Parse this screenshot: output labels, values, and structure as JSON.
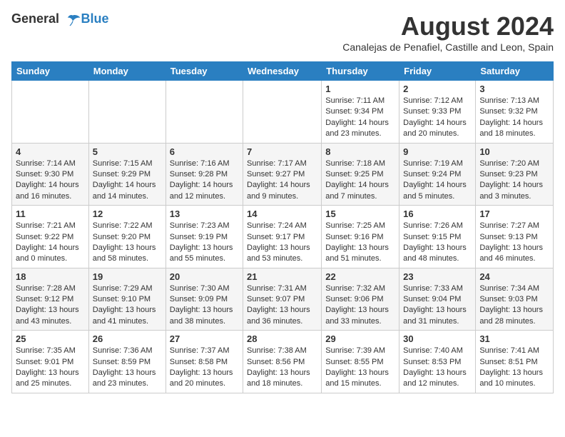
{
  "header": {
    "logo_general": "General",
    "logo_blue": "Blue",
    "month_year": "August 2024",
    "location": "Canalejas de Penafiel, Castille and Leon, Spain"
  },
  "weekdays": [
    "Sunday",
    "Monday",
    "Tuesday",
    "Wednesday",
    "Thursday",
    "Friday",
    "Saturday"
  ],
  "weeks": [
    [
      {
        "day": "",
        "info": ""
      },
      {
        "day": "",
        "info": ""
      },
      {
        "day": "",
        "info": ""
      },
      {
        "day": "",
        "info": ""
      },
      {
        "day": "1",
        "info": "Sunrise: 7:11 AM\nSunset: 9:34 PM\nDaylight: 14 hours\nand 23 minutes."
      },
      {
        "day": "2",
        "info": "Sunrise: 7:12 AM\nSunset: 9:33 PM\nDaylight: 14 hours\nand 20 minutes."
      },
      {
        "day": "3",
        "info": "Sunrise: 7:13 AM\nSunset: 9:32 PM\nDaylight: 14 hours\nand 18 minutes."
      }
    ],
    [
      {
        "day": "4",
        "info": "Sunrise: 7:14 AM\nSunset: 9:30 PM\nDaylight: 14 hours\nand 16 minutes."
      },
      {
        "day": "5",
        "info": "Sunrise: 7:15 AM\nSunset: 9:29 PM\nDaylight: 14 hours\nand 14 minutes."
      },
      {
        "day": "6",
        "info": "Sunrise: 7:16 AM\nSunset: 9:28 PM\nDaylight: 14 hours\nand 12 minutes."
      },
      {
        "day": "7",
        "info": "Sunrise: 7:17 AM\nSunset: 9:27 PM\nDaylight: 14 hours\nand 9 minutes."
      },
      {
        "day": "8",
        "info": "Sunrise: 7:18 AM\nSunset: 9:25 PM\nDaylight: 14 hours\nand 7 minutes."
      },
      {
        "day": "9",
        "info": "Sunrise: 7:19 AM\nSunset: 9:24 PM\nDaylight: 14 hours\nand 5 minutes."
      },
      {
        "day": "10",
        "info": "Sunrise: 7:20 AM\nSunset: 9:23 PM\nDaylight: 14 hours\nand 3 minutes."
      }
    ],
    [
      {
        "day": "11",
        "info": "Sunrise: 7:21 AM\nSunset: 9:22 PM\nDaylight: 14 hours\nand 0 minutes."
      },
      {
        "day": "12",
        "info": "Sunrise: 7:22 AM\nSunset: 9:20 PM\nDaylight: 13 hours\nand 58 minutes."
      },
      {
        "day": "13",
        "info": "Sunrise: 7:23 AM\nSunset: 9:19 PM\nDaylight: 13 hours\nand 55 minutes."
      },
      {
        "day": "14",
        "info": "Sunrise: 7:24 AM\nSunset: 9:17 PM\nDaylight: 13 hours\nand 53 minutes."
      },
      {
        "day": "15",
        "info": "Sunrise: 7:25 AM\nSunset: 9:16 PM\nDaylight: 13 hours\nand 51 minutes."
      },
      {
        "day": "16",
        "info": "Sunrise: 7:26 AM\nSunset: 9:15 PM\nDaylight: 13 hours\nand 48 minutes."
      },
      {
        "day": "17",
        "info": "Sunrise: 7:27 AM\nSunset: 9:13 PM\nDaylight: 13 hours\nand 46 minutes."
      }
    ],
    [
      {
        "day": "18",
        "info": "Sunrise: 7:28 AM\nSunset: 9:12 PM\nDaylight: 13 hours\nand 43 minutes."
      },
      {
        "day": "19",
        "info": "Sunrise: 7:29 AM\nSunset: 9:10 PM\nDaylight: 13 hours\nand 41 minutes."
      },
      {
        "day": "20",
        "info": "Sunrise: 7:30 AM\nSunset: 9:09 PM\nDaylight: 13 hours\nand 38 minutes."
      },
      {
        "day": "21",
        "info": "Sunrise: 7:31 AM\nSunset: 9:07 PM\nDaylight: 13 hours\nand 36 minutes."
      },
      {
        "day": "22",
        "info": "Sunrise: 7:32 AM\nSunset: 9:06 PM\nDaylight: 13 hours\nand 33 minutes."
      },
      {
        "day": "23",
        "info": "Sunrise: 7:33 AM\nSunset: 9:04 PM\nDaylight: 13 hours\nand 31 minutes."
      },
      {
        "day": "24",
        "info": "Sunrise: 7:34 AM\nSunset: 9:03 PM\nDaylight: 13 hours\nand 28 minutes."
      }
    ],
    [
      {
        "day": "25",
        "info": "Sunrise: 7:35 AM\nSunset: 9:01 PM\nDaylight: 13 hours\nand 25 minutes."
      },
      {
        "day": "26",
        "info": "Sunrise: 7:36 AM\nSunset: 8:59 PM\nDaylight: 13 hours\nand 23 minutes."
      },
      {
        "day": "27",
        "info": "Sunrise: 7:37 AM\nSunset: 8:58 PM\nDaylight: 13 hours\nand 20 minutes."
      },
      {
        "day": "28",
        "info": "Sunrise: 7:38 AM\nSunset: 8:56 PM\nDaylight: 13 hours\nand 18 minutes."
      },
      {
        "day": "29",
        "info": "Sunrise: 7:39 AM\nSunset: 8:55 PM\nDaylight: 13 hours\nand 15 minutes."
      },
      {
        "day": "30",
        "info": "Sunrise: 7:40 AM\nSunset: 8:53 PM\nDaylight: 13 hours\nand 12 minutes."
      },
      {
        "day": "31",
        "info": "Sunrise: 7:41 AM\nSunset: 8:51 PM\nDaylight: 13 hours\nand 10 minutes."
      }
    ]
  ]
}
